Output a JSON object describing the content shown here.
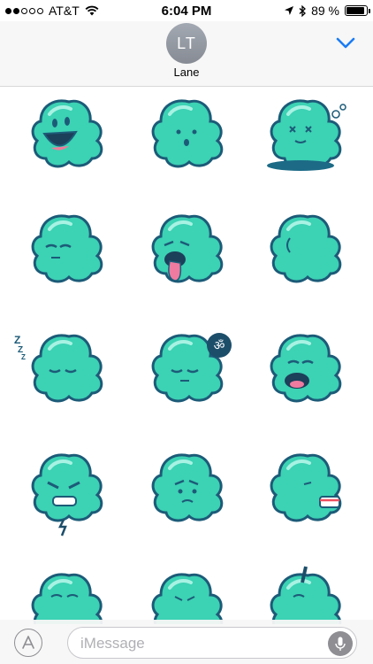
{
  "status_bar": {
    "carrier": "AT&T",
    "signal_bars_filled": 2,
    "signal_bars_total": 5,
    "time": "6:04 PM",
    "battery_percent_text": "89 %",
    "battery_level": 0.89
  },
  "header": {
    "avatar_initials": "LT",
    "contact_name": "Lane",
    "collapse_icon": "chevron-down-icon",
    "accent_color": "#1a7cf5"
  },
  "stickers": {
    "body_color": "#3cd2b4",
    "outline_color": "#1c5b78",
    "items": [
      {
        "mood": "laughing"
      },
      {
        "mood": "surprised"
      },
      {
        "mood": "dizzy-puddle"
      },
      {
        "mood": "squinting"
      },
      {
        "mood": "tongue-out"
      },
      {
        "mood": "facing-away"
      },
      {
        "mood": "sleeping"
      },
      {
        "mood": "meditating",
        "bubble_text": "ॐ"
      },
      {
        "mood": "yawning"
      },
      {
        "mood": "angry-lightning"
      },
      {
        "mood": "skeptical"
      },
      {
        "mood": "cake"
      },
      {
        "mood": "worried"
      },
      {
        "mood": "sweating"
      },
      {
        "mood": "pencil"
      }
    ]
  },
  "input_bar": {
    "app_store_icon": "app-store-icon",
    "message_placeholder": "iMessage",
    "mic_icon": "microphone-icon"
  }
}
